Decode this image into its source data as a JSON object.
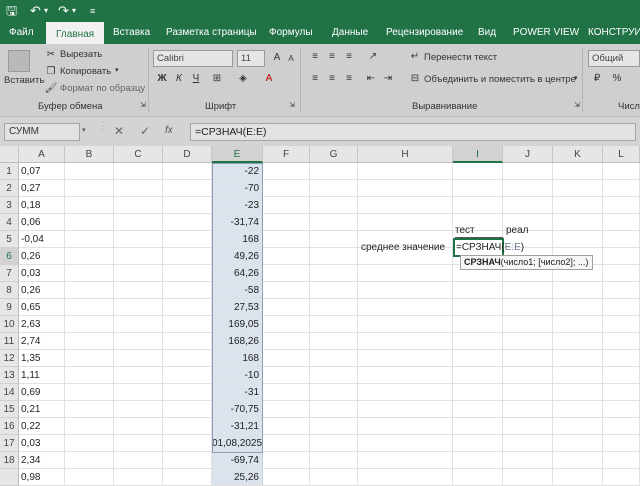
{
  "quick_access": {
    "save_icon": "save-icon",
    "undo_icon": "undo-icon",
    "redo_icon": "redo-icon",
    "customize_icon": "customize-icon"
  },
  "tabs": [
    "Файл",
    "Главная",
    "Вставка",
    "Разметка страницы",
    "Формулы",
    "Данные",
    "Рецензирование",
    "Вид",
    "POWER VIEW",
    "КОНСТРУИ"
  ],
  "ribbon": {
    "paste_label": "Вставить",
    "cut_label": "Вырезать",
    "copy_label": "Копировать",
    "format_painter_label": "Формат по образцу",
    "clipboard_group": "Буфер обмена",
    "font_name": "Calibri",
    "font_size": "11",
    "font_group": "Шрифт",
    "wrap_text_label": "Перенести текст",
    "merge_label": "Объединить и поместить в центре",
    "alignment_group": "Выравнивание",
    "number_format": "Общий",
    "number_group": "Числ"
  },
  "formula_bar": {
    "name_box": "СУММ",
    "cancel": "✕",
    "enter": "✓",
    "fx": "fx",
    "formula": "=СРЗНАЧ(E:E)"
  },
  "columns": [
    "A",
    "B",
    "C",
    "D",
    "E",
    "F",
    "G",
    "H",
    "I",
    "J",
    "K",
    "L"
  ],
  "rows": [
    "1",
    "2",
    "3",
    "4",
    "5",
    "6",
    "7",
    "8",
    "9",
    "10",
    "11",
    "12",
    "13",
    "14",
    "15",
    "16",
    "17",
    "18"
  ],
  "col_a": [
    "0,07",
    "0,27",
    "0,18",
    "0,06",
    "-0,04",
    "0,26",
    "0,03",
    "0,26",
    "0,65",
    "2,63",
    "2,74",
    "1,35",
    "1,11",
    "0,69",
    "0,21",
    "0,22",
    "0,03",
    "2,34",
    "0,98"
  ],
  "col_e": [
    "-22",
    "-70",
    "-23",
    "-31,74",
    "168",
    "49,26",
    "64,26",
    "-58",
    "27,53",
    "169,05",
    "168,26",
    "168",
    "-10",
    "-31",
    "-70,75",
    "-31,21",
    "01,08,2025",
    "-69,74",
    "25,26"
  ],
  "labels": {
    "test": "тест",
    "real": "реал",
    "average": "среднее значение",
    "cell_formula_prefix": "=СРЗНАЧ(",
    "cell_formula_ref": "E:E",
    "cell_formula_suffix": ")",
    "tooltip_func": "СРЗНАЧ",
    "tooltip_args": "(число1; [число2]; ...)"
  }
}
